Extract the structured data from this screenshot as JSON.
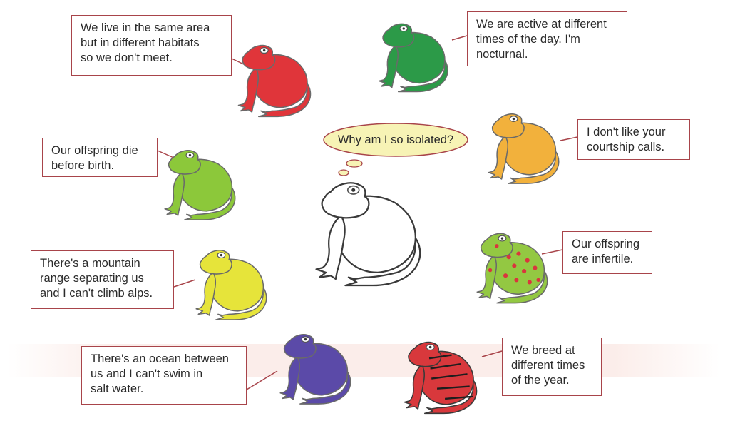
{
  "thought": "Why am I so isolated?",
  "boxes": {
    "habitat": "We live in the same area\nbut in different habitats\nso we don't meet.",
    "time_of_day": "We are active at different\ntimes of the day. I'm\nnocturnal.",
    "offspring_die": "Our offspring die\nbefore birth.",
    "courtship": "I don't like your\ncourtship calls.",
    "mountain": "There's a mountain\nrange separating us\nand I can't climb alps.",
    "infertile": "Our offspring\nare infertile.",
    "ocean": "There's an ocean between\nus and I can't swim in\nsalt water.",
    "breed_time": "We breed at\ndifferent times\nof the year."
  },
  "colors": {
    "box_border": "#a8444a",
    "thought_fill": "#f7f3b5",
    "thought_border": "#a8444a",
    "frog_red": "#e0353a",
    "frog_green": "#2c9a48",
    "frog_orange": "#f2b13c",
    "frog_lime": "#8cc83a",
    "frog_yellow": "#e6e43a",
    "frog_spotted": "#93c842",
    "frog_spots": "#d9363d",
    "frog_purple": "#5b4aa8",
    "frog_striped": "#d8383c",
    "frog_outline": "#6a6a6a"
  }
}
